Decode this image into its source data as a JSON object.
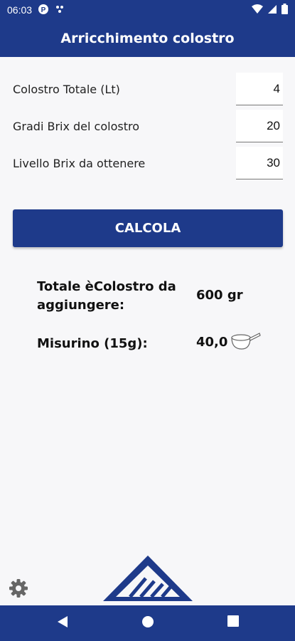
{
  "status_bar": {
    "time": "06:03"
  },
  "app_bar": {
    "title": "Arricchimento colostro"
  },
  "form": {
    "fields": [
      {
        "label": "Colostro Totale (Lt)",
        "value": "4"
      },
      {
        "label": "Gradi Brix del colostro",
        "value": "20"
      },
      {
        "label": "Livello Brix da ottenere",
        "value": "30"
      }
    ]
  },
  "calc_button": {
    "label": "CALCOLA"
  },
  "results": {
    "total_label_line1": "Totale èColostro da",
    "total_label_line2": "aggiungere:",
    "total_value": "600 gr",
    "scoop_label": "Misurino (15g):",
    "scoop_value": "40,0"
  },
  "colors": {
    "primary": "#1e3a8a",
    "background": "#f7f7f9"
  },
  "icons": [
    "settings-icon",
    "scoop-icon",
    "brand-logo",
    "wifi-icon",
    "battery-icon",
    "back-icon",
    "home-icon",
    "recents-icon"
  ]
}
